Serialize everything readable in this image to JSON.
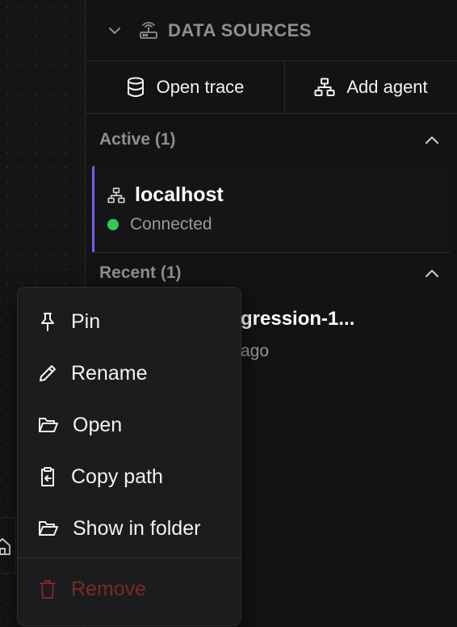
{
  "panel": {
    "title": "DATA SOURCES",
    "actions": {
      "open_trace": "Open trace",
      "add_agent": "Add agent"
    }
  },
  "active": {
    "label": "Active (1)",
    "items": [
      {
        "name": "localhost",
        "status": "Connected",
        "status_color": "#34c759",
        "accent": "#7b5cf0"
      }
    ]
  },
  "recent": {
    "label": "Recent (1)",
    "items": [
      {
        "name": "gression-1...",
        "time": "ago"
      }
    ]
  },
  "context_menu": {
    "items": [
      {
        "label": "Pin",
        "icon": "pin-icon"
      },
      {
        "label": "Rename",
        "icon": "pencil-icon"
      },
      {
        "label": "Open",
        "icon": "folder-open-icon"
      },
      {
        "label": "Copy path",
        "icon": "clipboard-copy-icon"
      },
      {
        "label": "Show in folder",
        "icon": "folder-icon"
      }
    ],
    "danger": {
      "label": "Remove",
      "icon": "trash-icon",
      "color": "#7a2a26"
    }
  }
}
